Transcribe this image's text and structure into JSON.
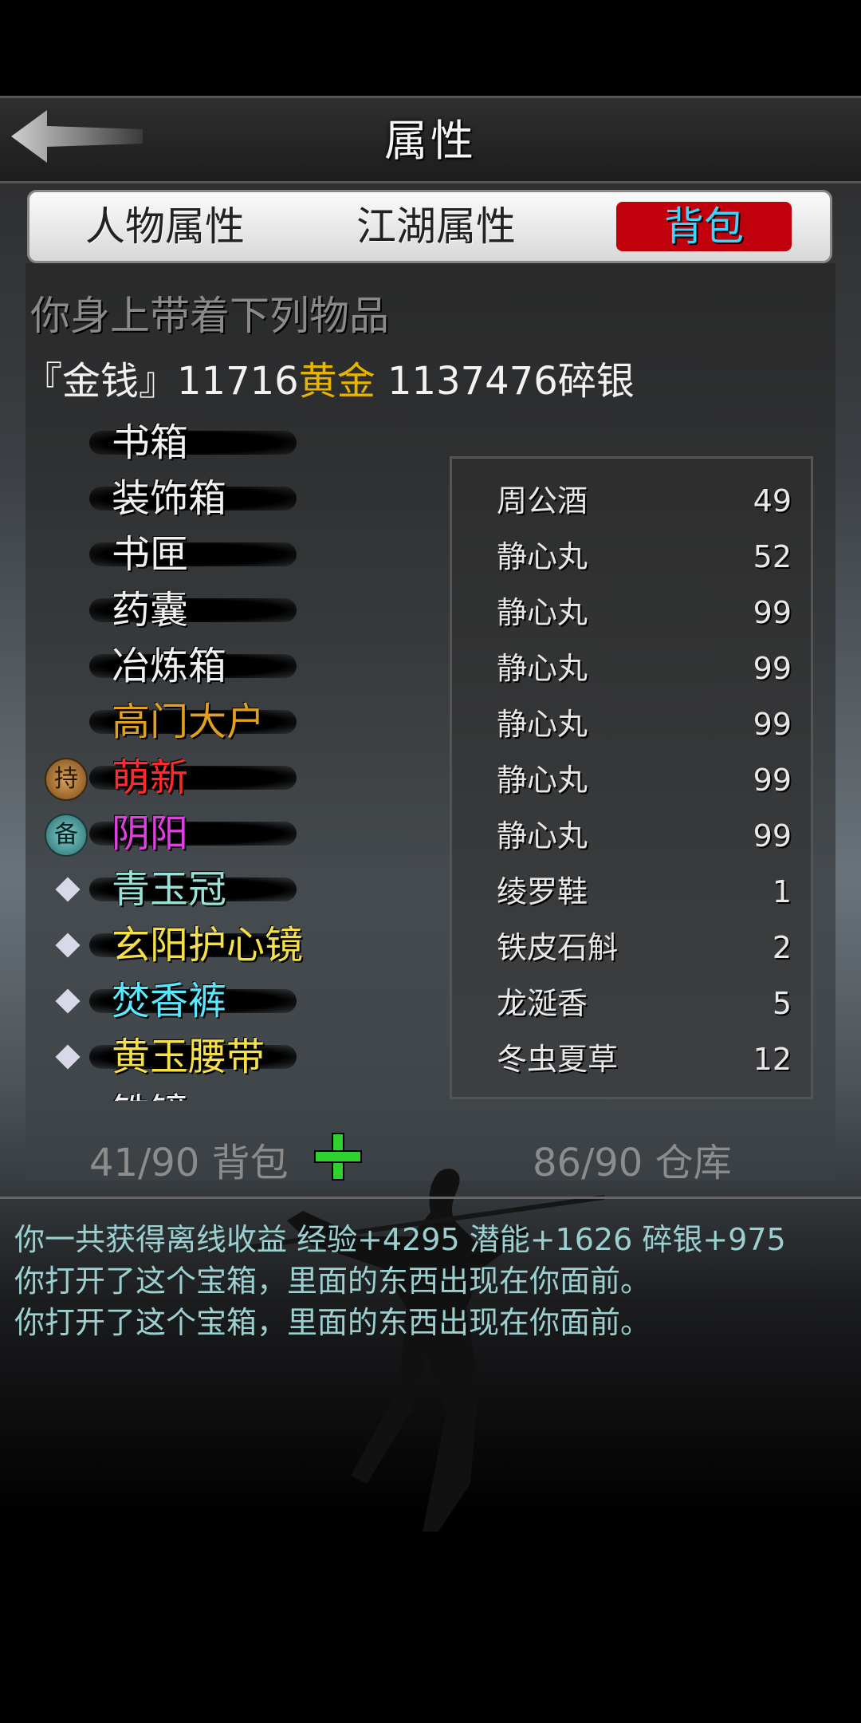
{
  "header": {
    "title": "属性",
    "back_icon": "back-arrow-icon"
  },
  "tabs": [
    {
      "label": "人物属性",
      "active": false
    },
    {
      "label": "江湖属性",
      "active": false
    },
    {
      "label": "背包",
      "active": true
    }
  ],
  "hint": "你身上带着下列物品",
  "money": {
    "prefix": "『金钱』",
    "gold_amount": "11716",
    "gold_label": "黄金",
    "silver": " 1137476碎银"
  },
  "equipment": [
    {
      "label": "书箱",
      "color": "#f0f0f0",
      "marker": ""
    },
    {
      "label": "装饰箱",
      "color": "#f0f0f0",
      "marker": ""
    },
    {
      "label": "书匣",
      "color": "#f0f0f0",
      "marker": ""
    },
    {
      "label": "药囊",
      "color": "#f0f0f0",
      "marker": ""
    },
    {
      "label": "冶炼箱",
      "color": "#f0f0f0",
      "marker": ""
    },
    {
      "label": "高门大户",
      "color": "#e0a020",
      "marker": ""
    },
    {
      "label": "萌新",
      "color": "#ff2a2a",
      "marker": "持"
    },
    {
      "label": "阴阳",
      "color": "#e040e0",
      "marker": "备"
    },
    {
      "label": "青玉冠",
      "color": "#9ae2d8",
      "marker": "diamond"
    },
    {
      "label": "玄阳护心镜",
      "color": "#f5e04a",
      "marker": "diamond"
    },
    {
      "label": "焚香裤",
      "color": "#5ae8ff",
      "marker": "diamond"
    },
    {
      "label": "黄玉腰带",
      "color": "#f5e04a",
      "marker": "diamond"
    },
    {
      "label": "铁镜",
      "color": "#f0f0f0",
      "marker": ""
    }
  ],
  "inventory": [
    {
      "name": "周公酒",
      "count": "49"
    },
    {
      "name": "静心丸",
      "count": "52"
    },
    {
      "name": "静心丸",
      "count": "99"
    },
    {
      "name": "静心丸",
      "count": "99"
    },
    {
      "name": "静心丸",
      "count": "99"
    },
    {
      "name": "静心丸",
      "count": "99"
    },
    {
      "name": "静心丸",
      "count": "99"
    },
    {
      "name": "绫罗鞋",
      "count": "1"
    },
    {
      "name": "铁皮石斛",
      "count": "2"
    },
    {
      "name": "龙涎香",
      "count": "5"
    },
    {
      "name": "冬虫夏草",
      "count": "12"
    }
  ],
  "footer": {
    "bag": "41/90 背包",
    "warehouse": "86/90 仓库"
  },
  "log": [
    "你一共获得离线收益 经验+4295 潜能+1626 碎银+975",
    "你打开了这个宝箱，里面的东西出现在你面前。",
    "你打开了这个宝箱，里面的东西出现在你面前。"
  ]
}
